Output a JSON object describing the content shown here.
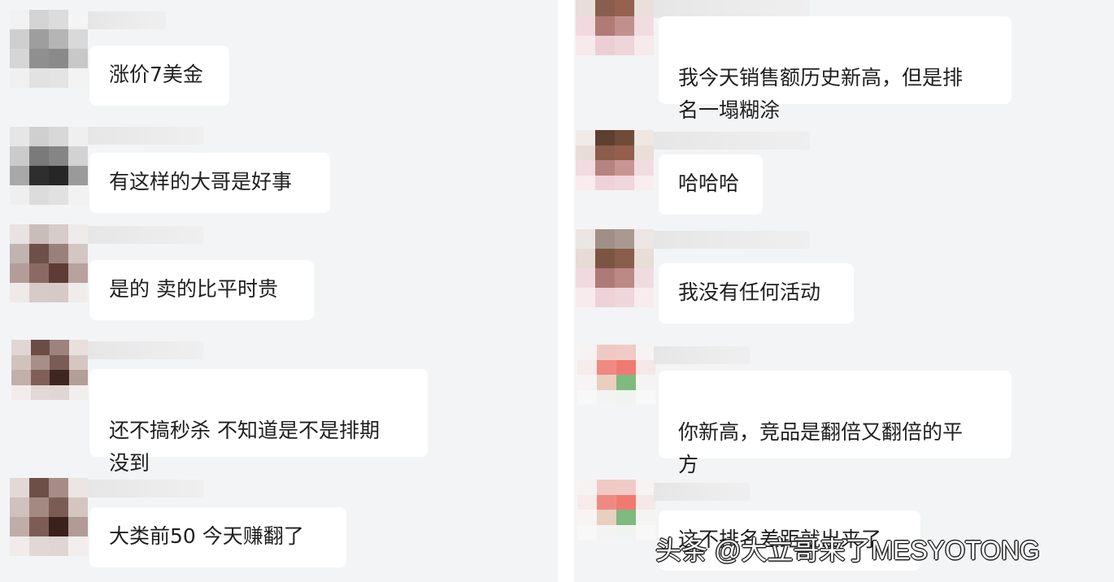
{
  "left_chat": {
    "messages": [
      {
        "text": "涨价7美金"
      },
      {
        "text": "有这样的大哥是好事"
      },
      {
        "text": "是的 卖的比平时贵"
      },
      {
        "text": "还不搞秒杀 不知道是不是排期\n没到"
      },
      {
        "text": "大类前50  今天赚翻了"
      }
    ]
  },
  "right_chat": {
    "messages": [
      {
        "text": "我今天销售额历史新高，但是排\n名一塌糊涂"
      },
      {
        "text": "哈哈哈"
      },
      {
        "text": "我没有任何活动"
      },
      {
        "text": "你新高，竞品是翻倍又翻倍的平\n方"
      },
      {
        "text": "这不排名差距就出来了"
      }
    ]
  },
  "watermark": "头条 @大立哥来了MESYOTONG"
}
